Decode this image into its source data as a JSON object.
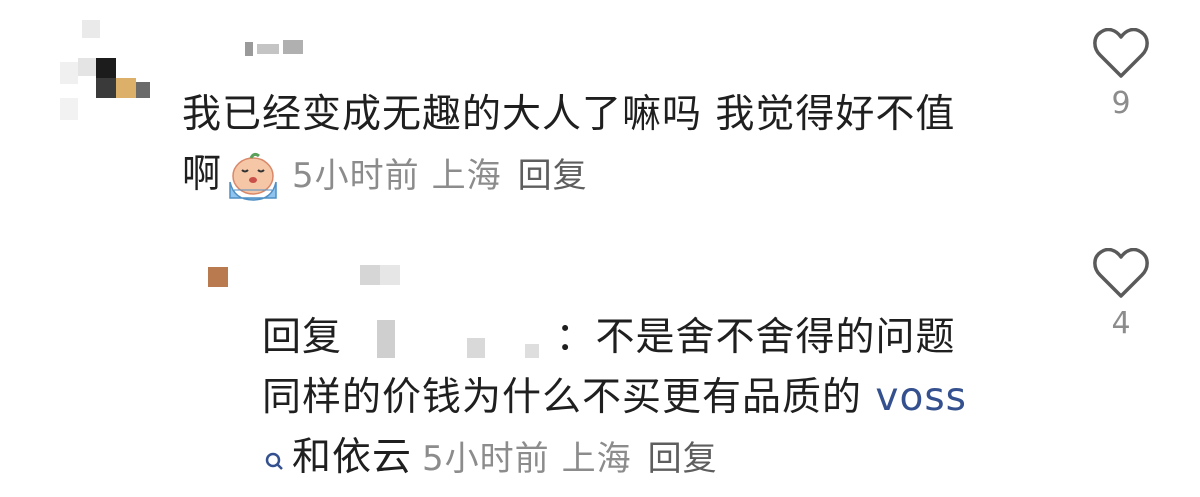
{
  "comments": [
    {
      "text_line1": "我已经变成无趣的大人了嘛吗 我觉得好不值",
      "text_line2": "啊",
      "emoji": "crying-emoji",
      "time": "5小时前",
      "location": "上海",
      "reply_label": "回复",
      "likes": "9"
    },
    {
      "reply_prefix": "回复",
      "colon": "：",
      "text_line1": "不是舍不舍得的问题",
      "text_line2": "同样的价钱为什么不买更有品质的",
      "link_text": "voss",
      "text_line3": "和依云",
      "time": "5小时前",
      "location": "上海",
      "reply_label": "回复",
      "likes": "4"
    }
  ],
  "colors": {
    "text": "#1f1f1f",
    "meta": "#8c8c8c",
    "link": "#34508e",
    "heart_stroke": "#5a5a5a"
  }
}
